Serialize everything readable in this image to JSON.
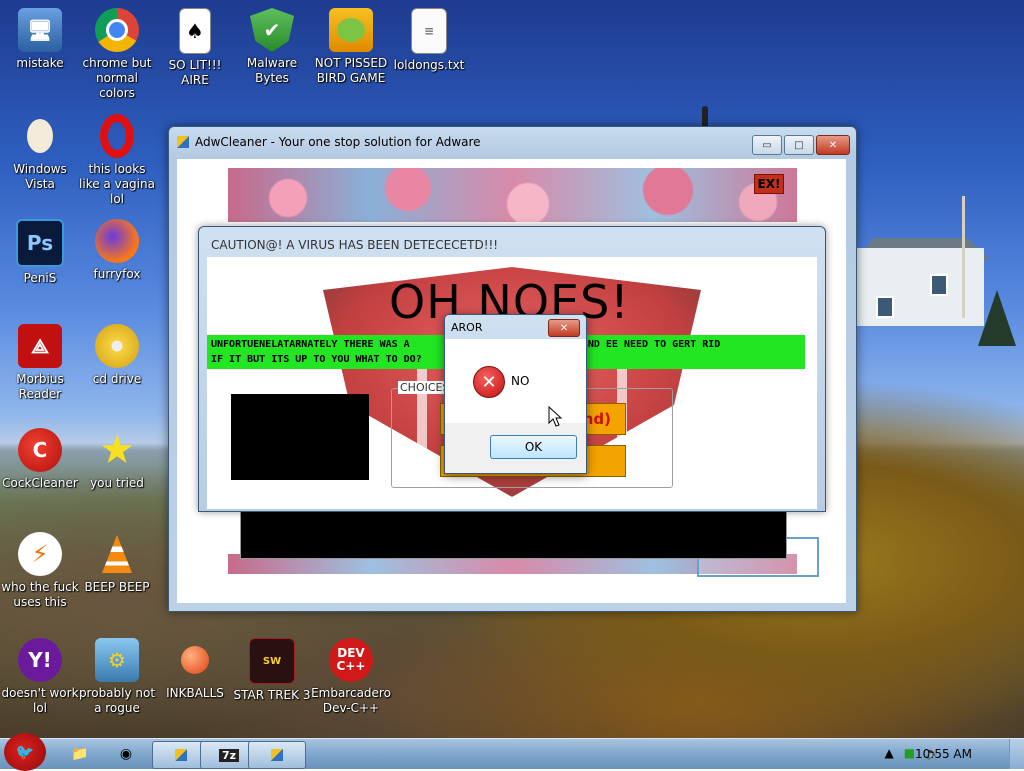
{
  "desktop_icons": [
    {
      "label": "mistake",
      "icon": "computer-icon"
    },
    {
      "label": "chrome but normal colors",
      "icon": "chrome-icon"
    },
    {
      "label": "SO LIT!!! AIRE",
      "icon": "solitaire-icon"
    },
    {
      "label": "Malware Bytes",
      "icon": "shield-check-icon"
    },
    {
      "label": "NOT PISSED BIRD GAME",
      "icon": "pig-icon"
    },
    {
      "label": "loldongs.txt",
      "icon": "text-file-icon"
    },
    {
      "label": "Windows Vista",
      "icon": "egg-icon"
    },
    {
      "label": "this looks like a vagina lol",
      "icon": "opera-icon"
    },
    {
      "label": "PeniS",
      "icon": "photoshop-icon"
    },
    {
      "label": "furryfox",
      "icon": "firefox-icon"
    },
    {
      "label": "Morbius Reader",
      "icon": "pdf-reader-icon"
    },
    {
      "label": "cd drive",
      "icon": "cd-icon"
    },
    {
      "label": "CockCleaner",
      "icon": "ccleaner-icon"
    },
    {
      "label": "you tried",
      "icon": "star-icon"
    },
    {
      "label": "who the fuck uses this",
      "icon": "lightning-icon"
    },
    {
      "label": "BEEP BEEP",
      "icon": "vlc-cone-icon"
    },
    {
      "label": "doesn't work lol",
      "icon": "yahoo-icon"
    },
    {
      "label": "probably not a rogue",
      "icon": "gear-monitor-icon"
    },
    {
      "label": "INKBALLS",
      "icon": "inkball-icon"
    },
    {
      "label": "STAR TREK 3",
      "icon": "star-wars-icon"
    },
    {
      "label": "Embarcadero Dev-C++",
      "icon": "devcpp-icon"
    }
  ],
  "adw_window": {
    "title": "AdwCleaner - Your one stop solution for Adware",
    "ex_badge": "EX!",
    "minimize": "▭",
    "maximize": "□",
    "close": "✕"
  },
  "caution_window": {
    "title": "CAUTION@! A VIRUS HAS BEEN DETECECETD!!!",
    "headline": "OH NOES!",
    "green_line_1": "UNFORTUENELATARNATELY THERE WAS A",
    "green_line_1_end": "PUTER ASND EE NEED TO GERT RID",
    "green_line_2": "IF IT BUT ITS UP TO YOU WHAT TO DO?",
    "choices_label": "CHOICES",
    "choice_1_text": "nd)"
  },
  "error_dialog": {
    "title": "AROR",
    "close": "✕",
    "message": "NO",
    "ok_label": "OK"
  },
  "taskbar": {
    "ex_task_label": "7z",
    "clock": "10:55 AM"
  }
}
